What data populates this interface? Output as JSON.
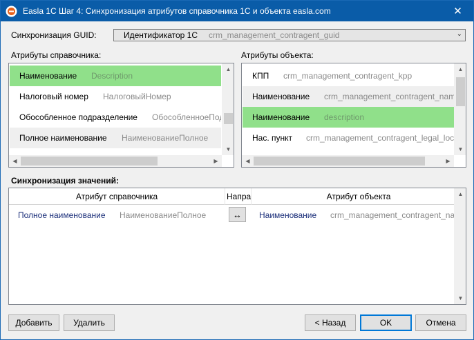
{
  "window": {
    "title": "Easla 1С Шаг 4: Синхронизация атрибутов справочника 1С и объекта easla.com"
  },
  "guid": {
    "label": "Синхронизация GUID:",
    "selected_name": "Идентификатор 1С",
    "selected_field": "crm_management_contragent_guid"
  },
  "catalog_attrs": {
    "label": "Атрибуты справочника:",
    "items": [
      {
        "name": "Наименование",
        "field": "Description",
        "state": "selected"
      },
      {
        "name": "Налоговый номер",
        "field": "НалоговыйНомер",
        "state": "normal"
      },
      {
        "name": "Обособленное подразделение",
        "field": "ОбособленноеПодразделение",
        "state": "normal"
      },
      {
        "name": "Полное наименование",
        "field": "НаименованиеПолное",
        "state": "alt"
      }
    ]
  },
  "object_attrs": {
    "label": "Атрибуты объекта:",
    "items": [
      {
        "name": "КПП",
        "field": "crm_management_contragent_kpp",
        "state": "normal"
      },
      {
        "name": "Наименование",
        "field": "crm_management_contragent_name",
        "state": "alt"
      },
      {
        "name": "Наименование",
        "field": "description",
        "state": "selected"
      },
      {
        "name": "Нас. пункт",
        "field": "crm_management_contragent_legal_locality",
        "state": "normal"
      }
    ]
  },
  "sync_values": {
    "label": "Синхронизация значений:",
    "columns": {
      "catalog_attr": "Атрибут справочника",
      "direction": "Направление",
      "object_attr": "Атрибут объекта"
    },
    "rows": [
      {
        "catalog_name": "Полное наименование",
        "catalog_field": "НаименованиеПолное",
        "direction": "↔",
        "object_name": "Наименование",
        "object_field": "crm_management_contragent_name"
      }
    ]
  },
  "buttons": {
    "add": "Добавить",
    "delete": "Удалить",
    "back": "< Назад",
    "ok": "OK",
    "cancel": "Отмена"
  },
  "colors": {
    "titlebar": "#0a5ca8",
    "selected_row": "#90e08a",
    "link_text": "#1b2f7a"
  }
}
